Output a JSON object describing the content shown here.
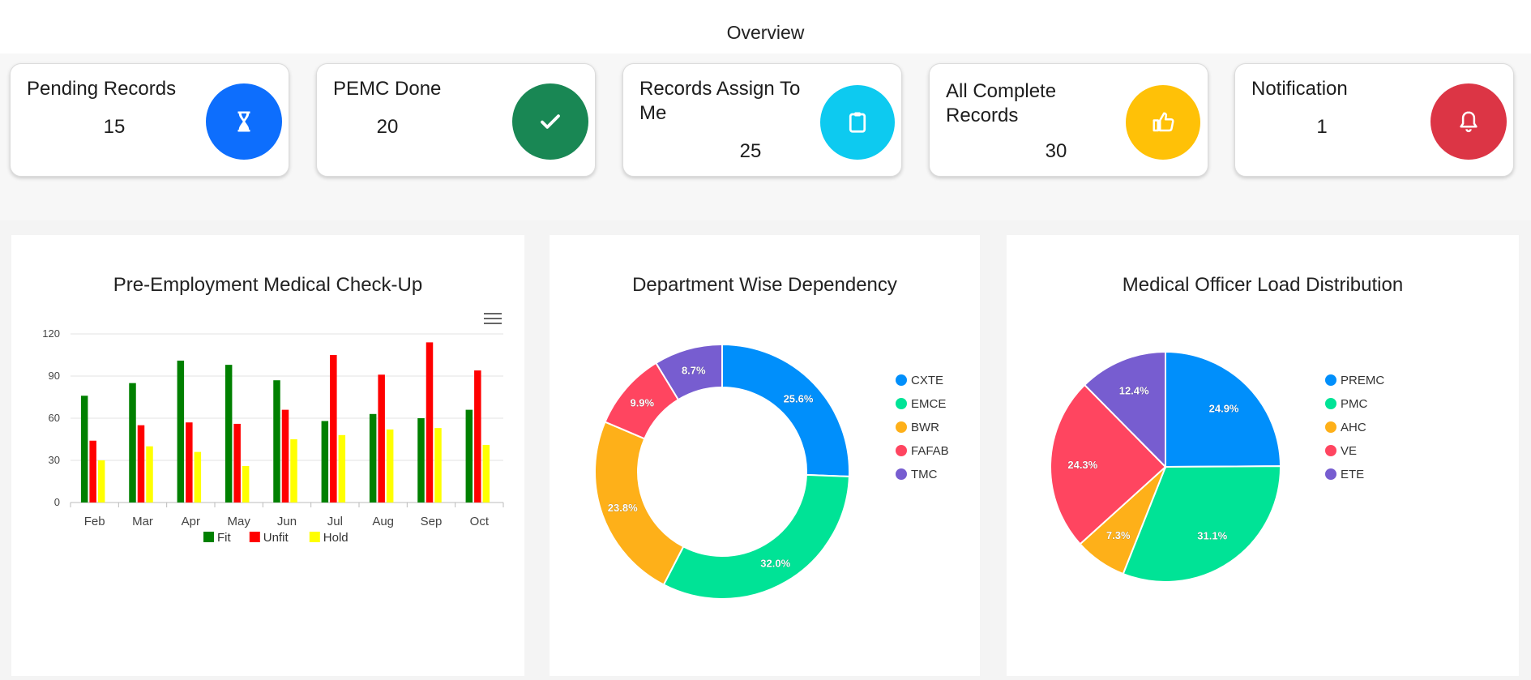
{
  "header": {
    "title": "Overview"
  },
  "cards": [
    {
      "title": "Pending Records",
      "value": "15",
      "icon": "hourglass-icon",
      "color": "#0d6efd"
    },
    {
      "title": "PEMC Done",
      "value": "20",
      "icon": "check-icon",
      "color": "#198754"
    },
    {
      "title": "Records Assign To Me",
      "value": "25",
      "icon": "clipboard-icon",
      "color": "#0dcaf0"
    },
    {
      "title": "All Complete Records",
      "value": "30",
      "icon": "thumbs-up-icon",
      "color": "#ffc107"
    },
    {
      "title": "Notification",
      "value": "1",
      "icon": "bell-icon",
      "color": "#dc3545"
    }
  ],
  "charts": {
    "bar": {
      "menu_icon": "hamburger-menu-icon"
    }
  },
  "chart_data": [
    {
      "type": "bar",
      "title": "Pre-Employment Medical Check-Up",
      "categories": [
        "Feb",
        "Mar",
        "Apr",
        "May",
        "Jun",
        "Jul",
        "Aug",
        "Sep",
        "Oct"
      ],
      "series": [
        {
          "name": "Fit",
          "color": "#008000",
          "values": [
            76,
            85,
            101,
            98,
            87,
            58,
            63,
            60,
            66
          ]
        },
        {
          "name": "Unfit",
          "color": "#ff0000",
          "values": [
            44,
            55,
            57,
            56,
            66,
            105,
            91,
            114,
            94
          ]
        },
        {
          "name": "Hold",
          "color": "#ffff00",
          "values": [
            30,
            40,
            36,
            26,
            45,
            48,
            52,
            53,
            41
          ]
        }
      ],
      "yticks": [
        "0",
        "30",
        "60",
        "90",
        "120"
      ],
      "ylim": [
        0,
        120
      ],
      "grid": true,
      "legend": "bottom"
    },
    {
      "type": "pie",
      "title": "Department Wise Dependency",
      "donut": true,
      "labels": [
        "CXTE",
        "EMCE",
        "BWR",
        "FAFAB",
        "TMC"
      ],
      "values": [
        25.6,
        32.0,
        23.8,
        9.9,
        8.7
      ],
      "data_labels": [
        "25.6%",
        "32.0%",
        "23.8%",
        "9.9%",
        "8.7%"
      ],
      "colors": [
        "#008ffb",
        "#00e396",
        "#feb019",
        "#ff4560",
        "#775dd0"
      ],
      "legend": "right"
    },
    {
      "type": "pie",
      "title": "Medical Officer Load Distribution",
      "donut": false,
      "labels": [
        "PREMC",
        "PMC",
        "AHC",
        "VE",
        "ETE"
      ],
      "values": [
        24.9,
        31.1,
        7.3,
        24.3,
        12.4
      ],
      "data_labels": [
        "24.9%",
        "31.1%",
        "7.3%",
        "24.3%",
        "12.4%"
      ],
      "colors": [
        "#008ffb",
        "#00e396",
        "#feb019",
        "#ff4560",
        "#775dd0"
      ],
      "legend": "right"
    }
  ]
}
